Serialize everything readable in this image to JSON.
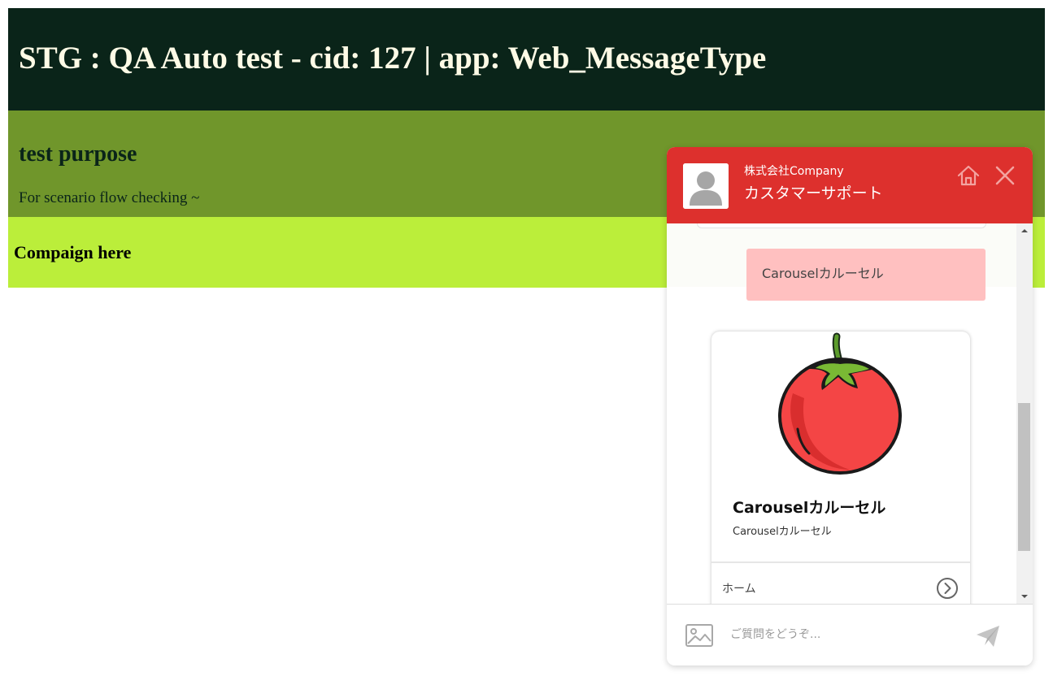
{
  "header": {
    "title": "STG : QA Auto test - cid: 127 | app: Web_MessageType"
  },
  "purpose": {
    "title": "test purpose",
    "text": "For scenario flow checking ~"
  },
  "campaign": {
    "text": "Compaign here"
  },
  "chat": {
    "company": "株式会社Company",
    "support_name": "カスタマーサポート",
    "user_message": "Carouselカルーセル",
    "card": {
      "title": "Carouselカルーセル",
      "subtitle": "Carouselカルーセル",
      "action_label": "ホーム"
    },
    "input_placeholder": "ご質問をどうぞ...",
    "icons": [
      "avatar-icon",
      "home-icon",
      "close-icon",
      "image-upload-icon",
      "send-icon",
      "chevron-right-icon"
    ]
  },
  "colors": {
    "header_bg": "#0a2419",
    "purpose_bg": "#70962b",
    "campaign_bg": "#bbee3a",
    "chat_header_bg": "#dd302d",
    "user_bubble_bg": "#ffc0c0"
  }
}
